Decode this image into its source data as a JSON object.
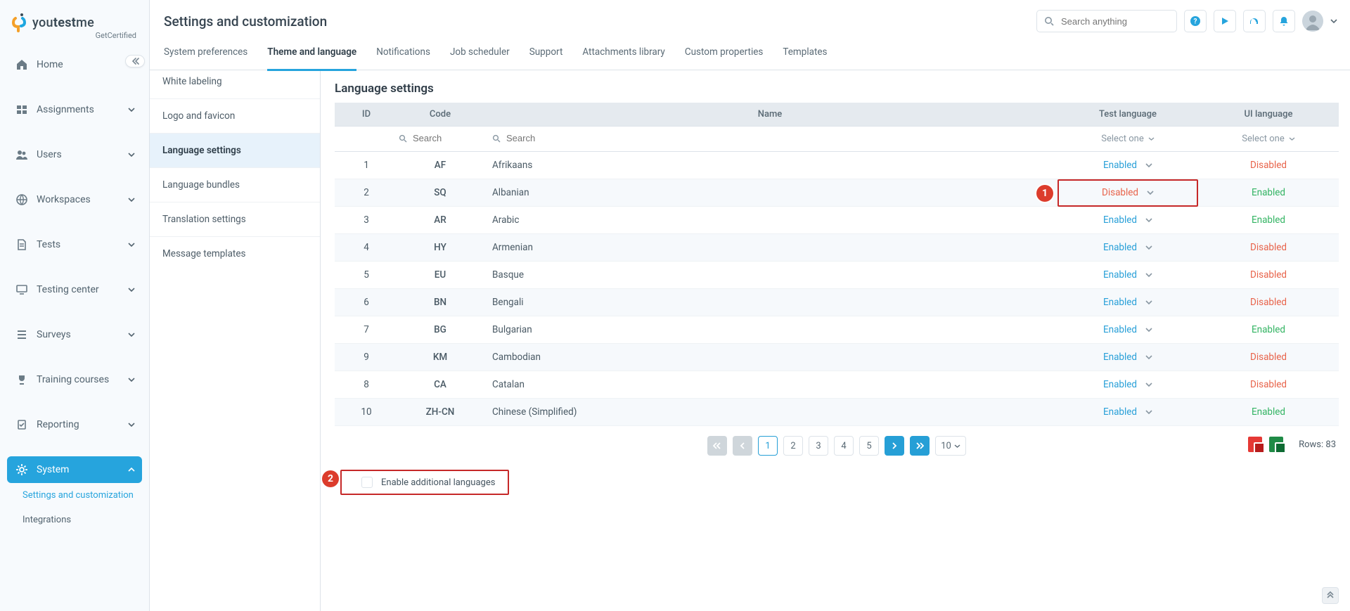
{
  "brand": {
    "name_prefix": "you",
    "name_bold": "test",
    "name_suffix": "me",
    "subtitle": "GetCertified"
  },
  "page_title": "Settings and customization",
  "search": {
    "placeholder": "Search anything"
  },
  "nav": {
    "items": [
      {
        "key": "home",
        "label": "Home",
        "expandable": false
      },
      {
        "key": "assignments",
        "label": "Assignments",
        "expandable": true
      },
      {
        "key": "users",
        "label": "Users",
        "expandable": true
      },
      {
        "key": "workspaces",
        "label": "Workspaces",
        "expandable": true
      },
      {
        "key": "tests",
        "label": "Tests",
        "expandable": true
      },
      {
        "key": "testing-center",
        "label": "Testing center",
        "expandable": true
      },
      {
        "key": "surveys",
        "label": "Surveys",
        "expandable": true
      },
      {
        "key": "training-courses",
        "label": "Training courses",
        "expandable": true
      },
      {
        "key": "reporting",
        "label": "Reporting",
        "expandable": true
      },
      {
        "key": "system",
        "label": "System",
        "expandable": true,
        "active": true
      }
    ],
    "system_children": [
      {
        "key": "settings-and-customization",
        "label": "Settings and customization",
        "current": true
      },
      {
        "key": "integrations",
        "label": "Integrations"
      }
    ]
  },
  "tabs": [
    {
      "key": "system-preferences",
      "label": "System preferences"
    },
    {
      "key": "theme-and-language",
      "label": "Theme and language",
      "active": true
    },
    {
      "key": "notifications",
      "label": "Notifications"
    },
    {
      "key": "job-scheduler",
      "label": "Job scheduler"
    },
    {
      "key": "support",
      "label": "Support"
    },
    {
      "key": "attachments-library",
      "label": "Attachments library"
    },
    {
      "key": "custom-properties",
      "label": "Custom properties"
    },
    {
      "key": "templates",
      "label": "Templates"
    }
  ],
  "submenu": [
    {
      "key": "white-labeling",
      "label": "White labeling"
    },
    {
      "key": "logo-and-favicon",
      "label": "Logo and favicon"
    },
    {
      "key": "language-settings",
      "label": "Language settings",
      "active": true
    },
    {
      "key": "language-bundles",
      "label": "Language bundles"
    },
    {
      "key": "translation-settings",
      "label": "Translation settings"
    },
    {
      "key": "message-templates",
      "label": "Message templates"
    }
  ],
  "section_title": "Language settings",
  "table": {
    "columns": {
      "id": "ID",
      "code": "Code",
      "name": "Name",
      "test_lang": "Test language",
      "ui_lang": "UI language"
    },
    "filters": {
      "code_placeholder": "Search",
      "name_placeholder": "Search",
      "test_select": "Select one",
      "ui_select": "Select one"
    },
    "rows": [
      {
        "id": "1",
        "code": "AF",
        "name": "Afrikaans",
        "test": "Enabled",
        "ui": "Disabled"
      },
      {
        "id": "2",
        "code": "SQ",
        "name": "Albanian",
        "test": "Disabled",
        "ui": "Enabled",
        "highlight": true
      },
      {
        "id": "3",
        "code": "AR",
        "name": "Arabic",
        "test": "Enabled",
        "ui": "Enabled"
      },
      {
        "id": "4",
        "code": "HY",
        "name": "Armenian",
        "test": "Enabled",
        "ui": "Disabled"
      },
      {
        "id": "5",
        "code": "EU",
        "name": "Basque",
        "test": "Enabled",
        "ui": "Disabled"
      },
      {
        "id": "6",
        "code": "BN",
        "name": "Bengali",
        "test": "Enabled",
        "ui": "Disabled"
      },
      {
        "id": "7",
        "code": "BG",
        "name": "Bulgarian",
        "test": "Enabled",
        "ui": "Enabled"
      },
      {
        "id": "9",
        "code": "KM",
        "name": "Cambodian",
        "test": "Enabled",
        "ui": "Disabled"
      },
      {
        "id": "8",
        "code": "CA",
        "name": "Catalan",
        "test": "Enabled",
        "ui": "Disabled"
      },
      {
        "id": "10",
        "code": "ZH-CN",
        "name": "Chinese (Simplified)",
        "test": "Enabled",
        "ui": "Enabled"
      }
    ]
  },
  "pagination": {
    "pages": [
      "1",
      "2",
      "3",
      "4",
      "5"
    ],
    "current": "1",
    "page_size": "10",
    "rows_label": "Rows: 83"
  },
  "enable_additional": {
    "label": "Enable additional languages",
    "checked": false
  },
  "callouts": {
    "one": "1",
    "two": "2"
  }
}
